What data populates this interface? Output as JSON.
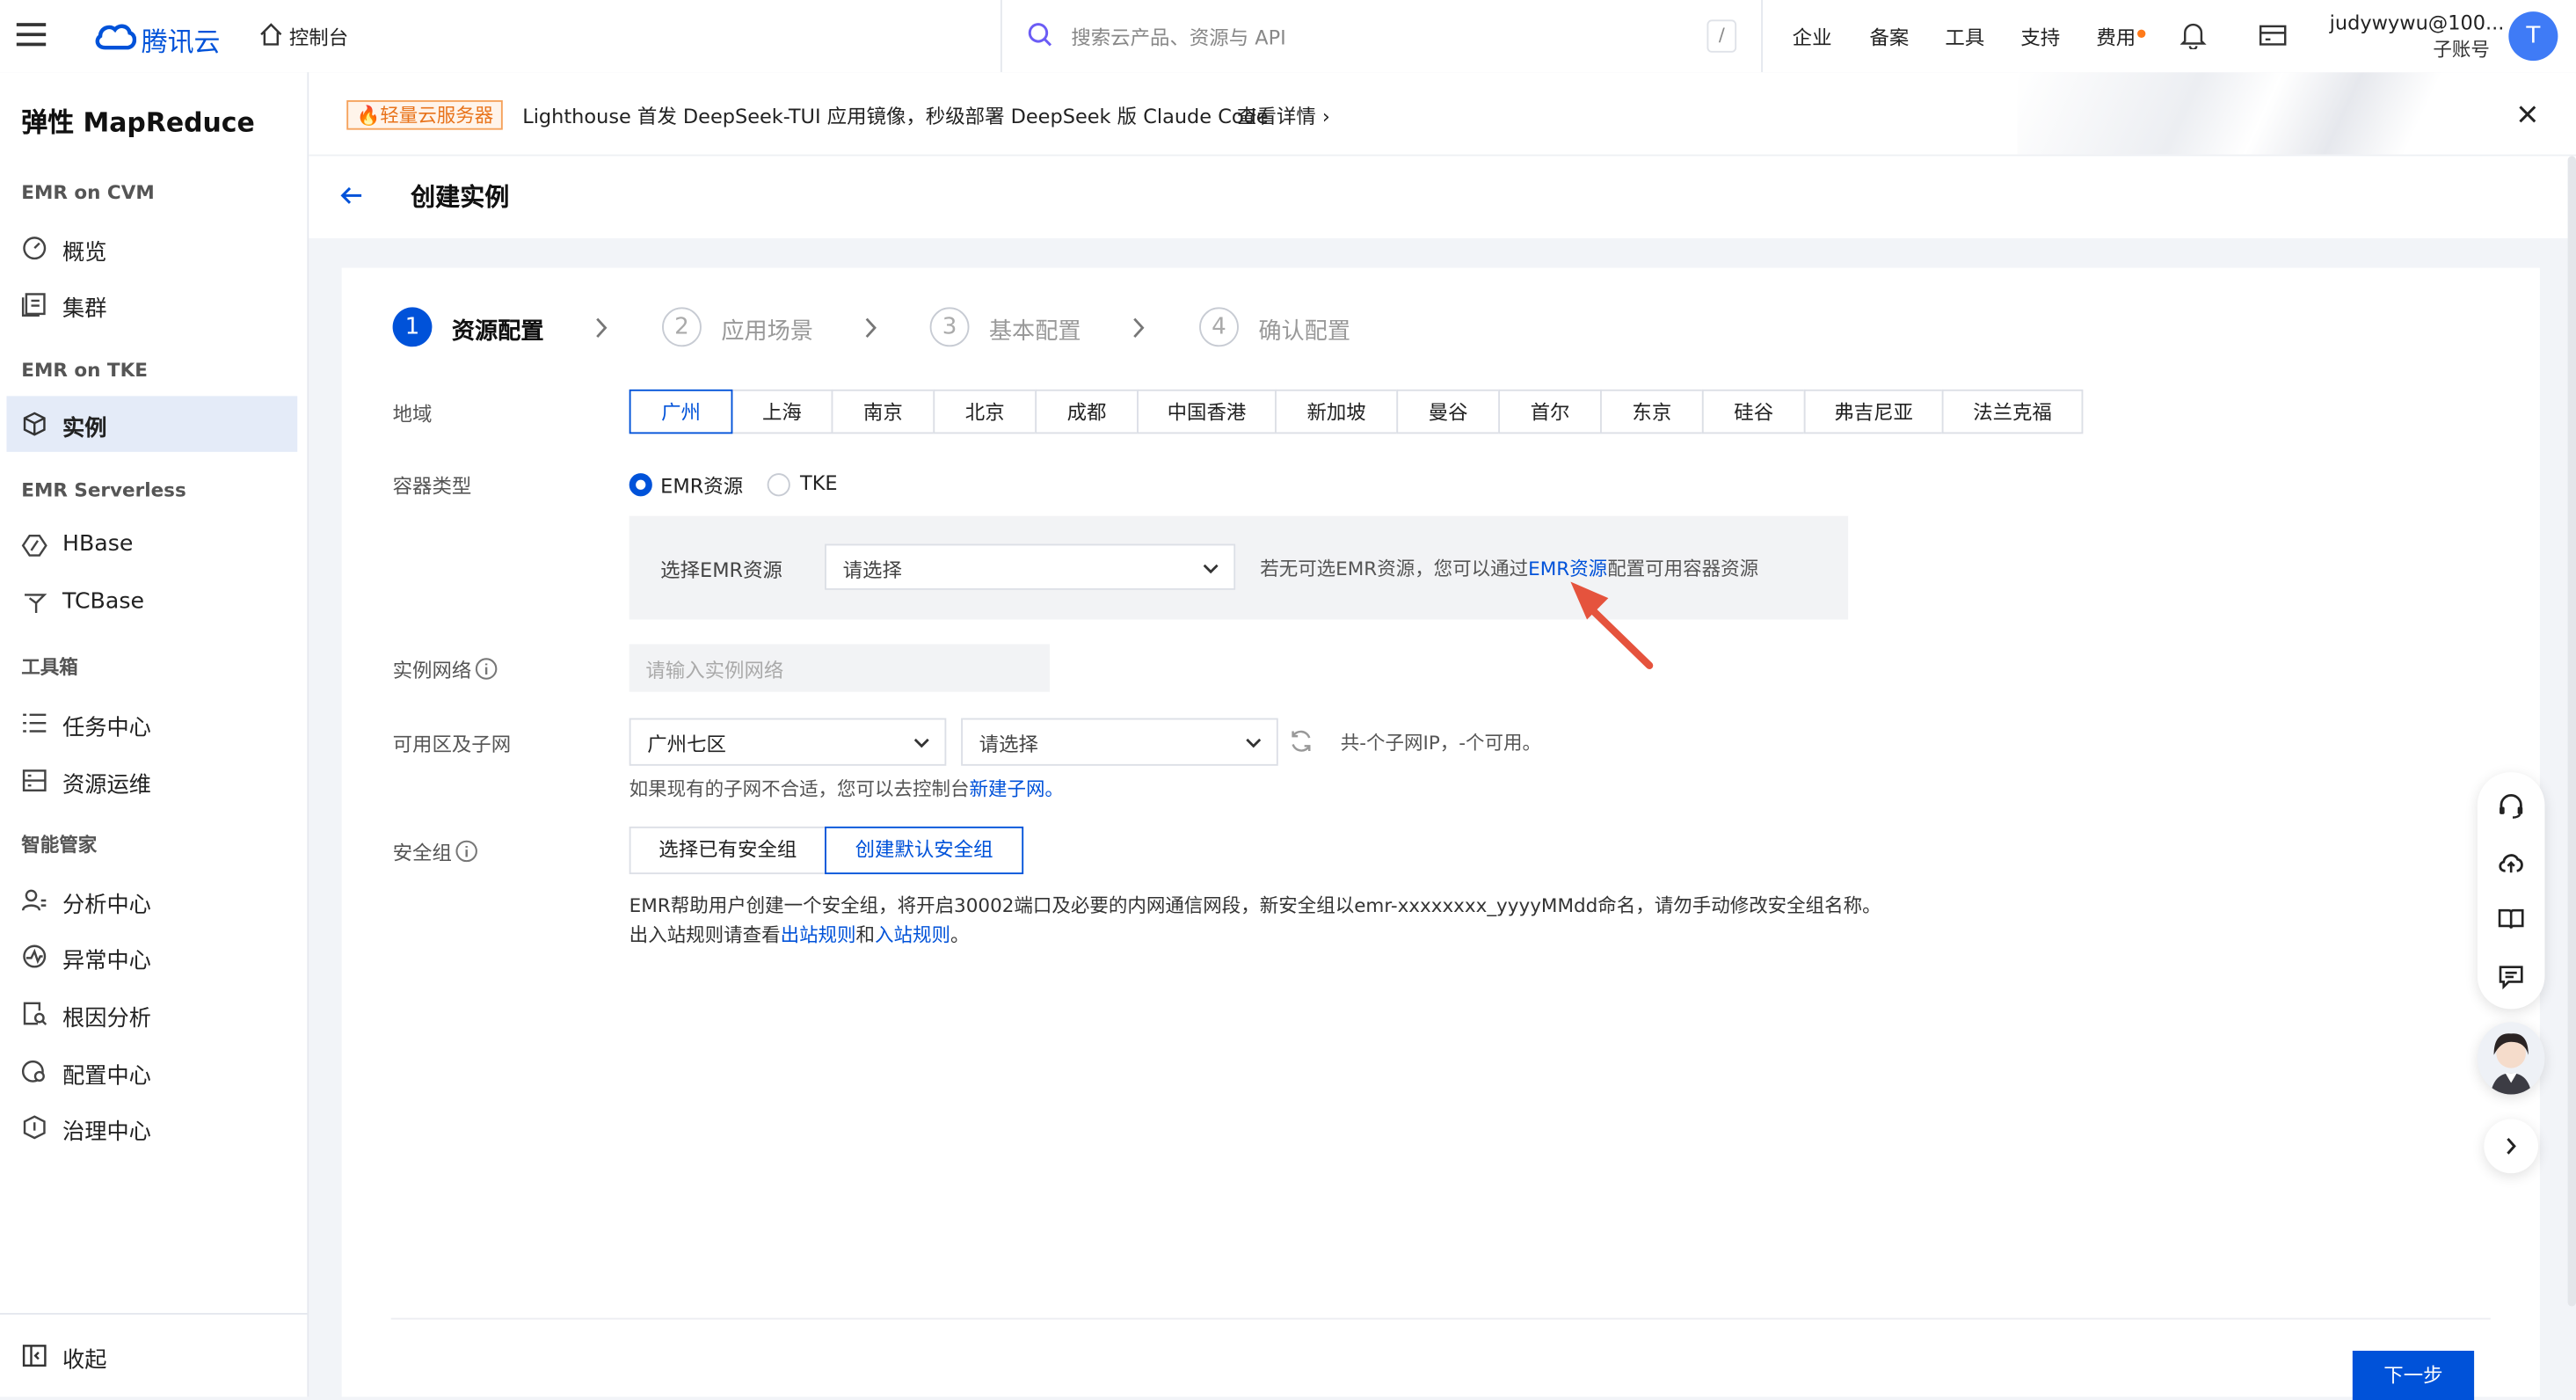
{
  "topbar": {
    "logo_text": "腾讯云",
    "console_label": "控制台",
    "search_placeholder": "搜索云产品、资源与 API",
    "search_shortcut": "/",
    "nav": [
      "企业",
      "备案",
      "工具",
      "支持",
      "费用"
    ],
    "user_name": "judywywu@100...",
    "user_role": "子账号",
    "avatar_letter": "T",
    "accent_color": "#0052d9"
  },
  "sidebar": {
    "title": "弹性 MapReduce",
    "groups": [
      {
        "label": "EMR on CVM",
        "items": [
          {
            "label": "概览",
            "icon": "dashboard-icon"
          },
          {
            "label": "集群",
            "icon": "cluster-icon"
          }
        ]
      },
      {
        "label": "EMR on TKE",
        "items": [
          {
            "label": "实例",
            "icon": "cube-icon",
            "active": true
          }
        ]
      },
      {
        "label": "EMR Serverless",
        "items": [
          {
            "label": "HBase",
            "icon": "hbase-icon"
          },
          {
            "label": "TCBase",
            "icon": "tcbase-icon"
          }
        ]
      },
      {
        "label": "工具箱",
        "items": [
          {
            "label": "任务中心",
            "icon": "list-icon"
          },
          {
            "label": "资源运维",
            "icon": "ops-icon"
          }
        ]
      },
      {
        "label": "智能管家",
        "items": [
          {
            "label": "分析中心",
            "icon": "user-analysis-icon"
          },
          {
            "label": "异常中心",
            "icon": "alert-icon"
          },
          {
            "label": "根因分析",
            "icon": "search-doc-icon"
          },
          {
            "label": "配置中心",
            "icon": "config-icon"
          },
          {
            "label": "治理中心",
            "icon": "shield-icon"
          }
        ]
      }
    ],
    "collapse_label": "收起"
  },
  "banner": {
    "tag": "轻量云服务器",
    "text": "Lighthouse 首发 DeepSeek-TUI 应用镜像，秒级部署 DeepSeek 版 Claude Code",
    "link": "查看详情"
  },
  "page": {
    "title": "创建实例"
  },
  "steps": [
    {
      "num": "1",
      "label": "资源配置",
      "active": true
    },
    {
      "num": "2",
      "label": "应用场景",
      "active": false
    },
    {
      "num": "3",
      "label": "基本配置",
      "active": false
    },
    {
      "num": "4",
      "label": "确认配置",
      "active": false
    }
  ],
  "form": {
    "region_label": "地域",
    "regions": [
      "广州",
      "上海",
      "南京",
      "北京",
      "成都",
      "中国香港",
      "新加坡",
      "曼谷",
      "首尔",
      "东京",
      "硅谷",
      "弗吉尼亚",
      "法兰克福"
    ],
    "selected_region": "广州",
    "container_type_label": "容器类型",
    "container_types": [
      "EMR资源",
      "TKE"
    ],
    "selected_container_type": "EMR资源",
    "emr_resource_label": "选择EMR资源",
    "emr_resource_placeholder": "请选择",
    "emr_hint_prefix": "若无可选EMR资源，您可以通过",
    "emr_hint_link": "EMR资源",
    "emr_hint_suffix": "配置可用容器资源",
    "network_label": "实例网络",
    "network_placeholder": "请输入实例网络",
    "zone_label": "可用区及子网",
    "zone_value": "广州七区",
    "subnet_placeholder": "请选择",
    "subnet_summary": "共-个子网IP，-个可用。",
    "subnet_hint_prefix": "如果现有的子网不合适，您可以去控制台",
    "subnet_hint_link": "新建子网。",
    "security_label": "安全组",
    "security_options": [
      "选择已有安全组",
      "创建默认安全组"
    ],
    "selected_security": "创建默认安全组",
    "security_note_line1": "EMR帮助用户创建一个安全组，将开启30002端口及必要的内网通信网段，新安全组以emr-xxxxxxxx_yyyyMMdd命名，请勿手动修改安全组名称。",
    "security_note_line2_prefix": "出入站规则请查看",
    "security_note_link1": "出站规则",
    "security_note_and": "和",
    "security_note_link2": "入站规则",
    "security_note_end": "。"
  },
  "footer": {
    "next_label": "下一步"
  },
  "float_tools": [
    "headset-icon",
    "cloud-upload-icon",
    "book-icon",
    "feedback-icon"
  ]
}
